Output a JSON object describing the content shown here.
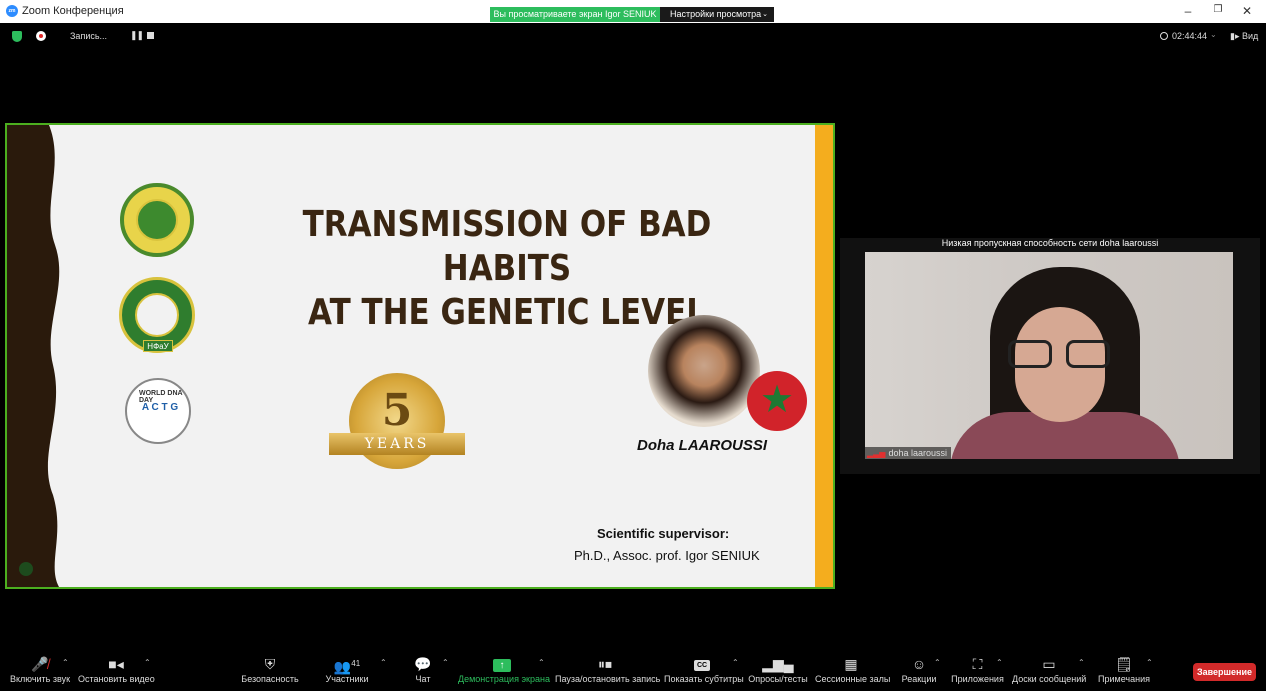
{
  "window": {
    "title": "Zoom Конференция",
    "viewing_banner": "Вы просматриваете экран Igor SENIUK",
    "view_settings": "Настройки просмотра",
    "minimize": "–",
    "restore": "❐",
    "close": "✕"
  },
  "topbar": {
    "recording_label": "Запись...",
    "timer": "02:44:44",
    "view_label": "Вид"
  },
  "slide": {
    "title_line1": "TRANSMISSION OF BAD HABITS",
    "title_line2": "AT THE GENETIC LEVEL",
    "badge_number": "5",
    "badge_text": "YEARS",
    "seal2_label": "НФаУ",
    "seal3_title": "WORLD DNA DAY",
    "seal3_bases": "A C T G",
    "speaker_name": "Doha LAAROUSSI",
    "supervisor_title": "Scientific supervisor:",
    "supervisor_name": "Ph.D., Assoc. prof. Igor SENIUK",
    "colors": {
      "border": "#4caf1f",
      "left_band": "#2a1a0c",
      "right_band": "#f4ad1e",
      "title": "#3a2612"
    }
  },
  "video": {
    "network_warning": "Низкая пропускная способность сети doha laaroussi",
    "participant_name": "doha laaroussi"
  },
  "toolbar": {
    "mute_label": "Включить звук",
    "video_label": "Остановить видео",
    "security_label": "Безопасность",
    "participants_label": "Участники",
    "participants_count": "41",
    "chat_label": "Чат",
    "share_label": "Демонстрация экрана",
    "record_label": "Пауза/остановить запись",
    "captions_label": "Показать субтитры",
    "captions_icon_text": "CC",
    "polls_label": "Опросы/тесты",
    "breakout_label": "Сессионные залы",
    "reactions_label": "Реакции",
    "apps_label": "Приложения",
    "whiteboard_label": "Доски сообщений",
    "notes_label": "Примечания",
    "end_label": "Завершение"
  }
}
